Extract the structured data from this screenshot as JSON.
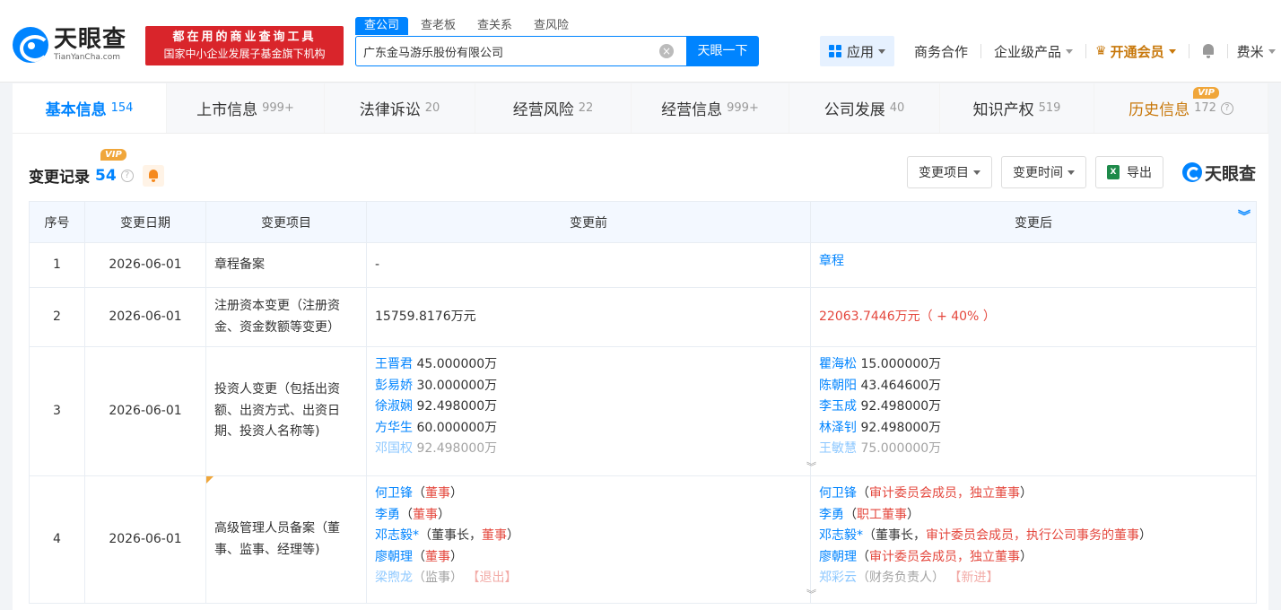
{
  "header": {
    "logo_cn": "天眼查",
    "logo_en": "TianYanCha.com",
    "slogan_line1": "都在用的商业查询工具",
    "slogan_line2": "国家中小企业发展子基金旗下机构",
    "search_tabs": [
      "查公司",
      "查老板",
      "查关系",
      "查风险"
    ],
    "search_value": "广东金马游乐股份有限公司",
    "search_button": "天眼一下",
    "app_label": "应用",
    "nav": [
      "商务合作",
      "企业级产品"
    ],
    "vip_label": "开通会员",
    "user_name": "费米"
  },
  "tabs": [
    {
      "label": "基本信息",
      "count": "154"
    },
    {
      "label": "上市信息",
      "count": "999+"
    },
    {
      "label": "法律诉讼",
      "count": "20"
    },
    {
      "label": "经营风险",
      "count": "22"
    },
    {
      "label": "经营信息",
      "count": "999+"
    },
    {
      "label": "公司发展",
      "count": "40"
    },
    {
      "label": "知识产权",
      "count": "519"
    },
    {
      "label": "历史信息",
      "count": "172"
    }
  ],
  "vip_badge": "VIP",
  "section": {
    "title": "变更记录",
    "count": "54",
    "filter_item": "变更项目",
    "filter_time": "变更时间",
    "export": "导出",
    "brand": "天眼查"
  },
  "table": {
    "headers": [
      "序号",
      "变更日期",
      "变更项目",
      "变更前",
      "变更后"
    ],
    "rows": [
      {
        "idx": "1",
        "date": "2026-06-01",
        "item": "章程备案",
        "before": "-",
        "after": "章程"
      },
      {
        "idx": "2",
        "date": "2026-06-01",
        "item": "注册资本变更（注册资金、资金数额等变更）",
        "before": "15759.8176万元",
        "after": "22063.7446万元（ + 40% ）"
      },
      {
        "idx": "3",
        "date": "2026-06-01",
        "item": "投资人变更（包括出资额、出资方式、出资日期、投资人名称等)",
        "before": [
          {
            "name": "王晋君",
            "amount": "45.000000万"
          },
          {
            "name": "彭易娇",
            "amount": "30.000000万"
          },
          {
            "name": "徐淑娴",
            "amount": "92.498000万"
          },
          {
            "name": "方华生",
            "amount": "60.000000万"
          },
          {
            "name": "邓国权",
            "amount": "92.498000万"
          }
        ],
        "after": [
          {
            "name": "瞿海松",
            "amount": "15.000000万"
          },
          {
            "name": "陈朝阳",
            "amount": "43.464600万"
          },
          {
            "name": "李玉成",
            "amount": "92.498000万"
          },
          {
            "name": "林泽钊",
            "amount": "92.498000万"
          },
          {
            "name": "王敏慧",
            "amount": "75.000000万"
          }
        ]
      },
      {
        "idx": "4",
        "date": "2026-06-01",
        "item": "高级管理人员备案（董事、监事、经理等)",
        "before": [
          {
            "name": "何卫锋",
            "pre": "（",
            "role": "董事",
            "post": "）"
          },
          {
            "name": "李勇",
            "pre": "（",
            "role": "董事",
            "post": "）"
          },
          {
            "name": "邓志毅*",
            "pre": "（董事长，",
            "role": "董事",
            "post": "）"
          },
          {
            "name": "廖朝理",
            "pre": "（",
            "role": "董事",
            "post": "）"
          },
          {
            "name": "梁煦龙",
            "pre": "（监事）",
            "role": "",
            "post": "",
            "tag": "【退出】"
          }
        ],
        "after": [
          {
            "name": "何卫锋",
            "pre": "（",
            "role": "审计委员会成员，独立董事",
            "post": "）"
          },
          {
            "name": "李勇",
            "pre": "（",
            "role": "职工董事",
            "post": "）"
          },
          {
            "name": "邓志毅*",
            "pre": "（董事长，",
            "role": "审计委员会成员，执行公司事务的董事",
            "post": "）"
          },
          {
            "name": "廖朝理",
            "pre": "（",
            "role": "审计委员会成员，独立董事",
            "post": "）"
          },
          {
            "name": "郑彩云",
            "pre": "（财务负责人）",
            "role": "",
            "post": "",
            "tag": "【新进】"
          }
        ]
      }
    ]
  }
}
